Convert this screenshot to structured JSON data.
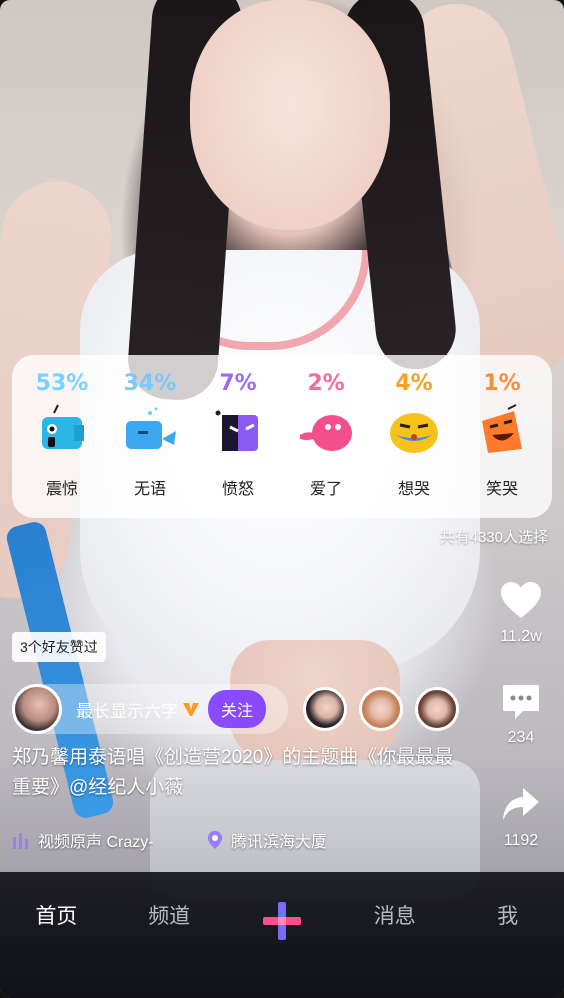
{
  "poll": {
    "options": [
      {
        "percent": "53%",
        "label": "震惊",
        "color": "#78d2ff",
        "icon": "shocked-emoji-icon"
      },
      {
        "percent": "34%",
        "label": "无语",
        "color": "#7cc8f7",
        "icon": "speechless-emoji-icon"
      },
      {
        "percent": "7%",
        "label": "愤怒",
        "color": "#9a6bf2",
        "icon": "angry-emoji-icon"
      },
      {
        "percent": "2%",
        "label": "爱了",
        "color": "#f56b9d",
        "icon": "love-emoji-icon"
      },
      {
        "percent": "4%",
        "label": "想哭",
        "color": "#f6a21e",
        "icon": "crying-emoji-icon"
      },
      {
        "percent": "1%",
        "label": "笑哭",
        "color": "#ff8a3c",
        "icon": "laugh-cry-emoji-icon"
      }
    ],
    "total": "共有4330人选择"
  },
  "actions": {
    "like_count": "11.2w",
    "comment_count": "234",
    "share_count": "1192"
  },
  "friends_liked": "3个好友赞过",
  "author": {
    "name": "最长显示六字",
    "follow_label": "关注"
  },
  "caption": "郑乃馨用泰语唱《创造营2020》的主题曲《你最最最重要》@经纪人小薇",
  "music": "视频原声  Crazy-",
  "location": "腾讯滨海大厦",
  "tabs": {
    "home": "首页",
    "channel": "频道",
    "messages": "消息",
    "me": "我"
  }
}
